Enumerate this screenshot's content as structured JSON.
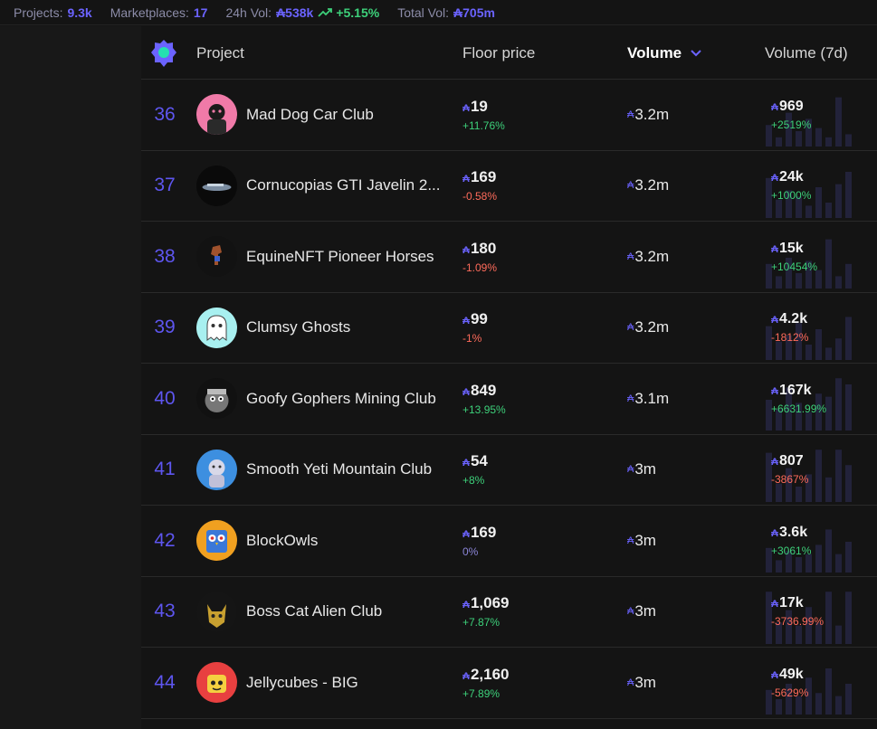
{
  "topbar": {
    "projects_label": "Projects:",
    "projects_value": "9.3k",
    "marketplaces_label": "Marketplaces:",
    "marketplaces_value": "17",
    "vol24_label": "24h Vol:",
    "vol24_value": "₳538k",
    "vol24_change": "+5.15%",
    "totalvol_label": "Total Vol:",
    "totalvol_value": "₳705m"
  },
  "header": {
    "project": "Project",
    "floor": "Floor price",
    "volume": "Volume",
    "volume7d": "Volume (7d)"
  },
  "colors": {
    "accent": "#6b63ff",
    "positive": "#3dd07a",
    "negative": "#ff6b5b",
    "bar": "#22223a"
  },
  "rows": [
    {
      "rank": "36",
      "name": "Mad Dog Car Club",
      "floor": "19",
      "floor_change": "+11.76%",
      "floor_dir": "pos",
      "volume": "3.2m",
      "vol7": "969",
      "vol7_change": "+2519%",
      "vol7_dir": "pos",
      "avatar_icon": "dog-avatar-icon",
      "avatar_bg": "#f07aa8",
      "bars": [
        0.35,
        0.15,
        0.55,
        0.25,
        0.45,
        0.3,
        0.15,
        0.8,
        0.2
      ]
    },
    {
      "rank": "37",
      "name": "Cornucopias GTI Javelin 2...",
      "floor": "169",
      "floor_change": "-0.58%",
      "floor_dir": "neg",
      "volume": "3.2m",
      "vol7": "24k",
      "vol7_change": "+1000%",
      "vol7_dir": "pos",
      "avatar_icon": "car-avatar-icon",
      "avatar_bg": "#0a0a0a",
      "bars": [
        0.65,
        0.3,
        0.45,
        0.35,
        0.2,
        0.5,
        0.25,
        0.55,
        0.75
      ]
    },
    {
      "rank": "38",
      "name": "EquineNFT Pioneer Horses",
      "floor": "180",
      "floor_change": "-1.09%",
      "floor_dir": "neg",
      "volume": "3.2m",
      "vol7": "15k",
      "vol7_change": "+10454%",
      "vol7_dir": "pos",
      "avatar_icon": "horse-avatar-icon",
      "avatar_bg": "#121212",
      "bars": [
        0.4,
        0.2,
        0.5,
        0.25,
        0.45,
        0.3,
        0.8,
        0.2,
        0.4
      ]
    },
    {
      "rank": "39",
      "name": "Clumsy Ghosts",
      "floor": "99",
      "floor_change": "-1%",
      "floor_dir": "neg",
      "volume": "3.2m",
      "vol7": "4.2k",
      "vol7_change": "-1812%",
      "vol7_dir": "neg",
      "avatar_icon": "ghost-avatar-icon",
      "avatar_bg": "#a8f0f0",
      "bars": [
        0.55,
        0.3,
        0.4,
        0.6,
        0.25,
        0.5,
        0.2,
        0.35,
        0.7
      ]
    },
    {
      "rank": "40",
      "name": "Goofy Gophers Mining Club",
      "floor": "849",
      "floor_change": "+13.95%",
      "floor_dir": "pos",
      "volume": "3.1m",
      "vol7": "167k",
      "vol7_change": "+6631.99%",
      "vol7_dir": "pos",
      "avatar_icon": "gopher-avatar-icon",
      "avatar_bg": "#111111",
      "bars": [
        0.5,
        0.35,
        0.7,
        0.45,
        0.3,
        0.6,
        0.55,
        0.85,
        0.75
      ]
    },
    {
      "rank": "41",
      "name": "Smooth Yeti Mountain Club",
      "floor": "54",
      "floor_change": "+8%",
      "floor_dir": "pos",
      "volume": "3m",
      "vol7": "807",
      "vol7_change": "-3867%",
      "vol7_dir": "neg",
      "avatar_icon": "yeti-avatar-icon",
      "avatar_bg": "#3d8fe0",
      "bars": [
        0.8,
        0.3,
        0.55,
        0.25,
        0.45,
        0.85,
        0.4,
        0.85,
        0.6
      ]
    },
    {
      "rank": "42",
      "name": "BlockOwls",
      "floor": "169",
      "floor_change": "0%",
      "floor_dir": "neu",
      "volume": "3m",
      "vol7": "3.6k",
      "vol7_change": "+3061%",
      "vol7_dir": "pos",
      "avatar_icon": "owl-avatar-icon",
      "avatar_bg": "#f0a020",
      "bars": [
        0.4,
        0.2,
        0.35,
        0.25,
        0.3,
        0.45,
        0.7,
        0.3,
        0.5
      ]
    },
    {
      "rank": "43",
      "name": "Boss Cat Alien Club",
      "floor": "1,069",
      "floor_change": "+7.87%",
      "floor_dir": "pos",
      "volume": "3m",
      "vol7": "17k",
      "vol7_change": "-3736.99%",
      "vol7_dir": "neg",
      "avatar_icon": "cat-alien-avatar-icon",
      "avatar_bg": "#151515",
      "bars": [
        0.85,
        0.35,
        0.55,
        0.3,
        0.6,
        0.35,
        0.85,
        0.3,
        0.85
      ]
    },
    {
      "rank": "44",
      "name": "Jellycubes - BIG",
      "floor": "2,160",
      "floor_change": "+7.89%",
      "floor_dir": "pos",
      "volume": "3m",
      "vol7": "49k",
      "vol7_change": "-5629%",
      "vol7_dir": "neg",
      "avatar_icon": "jellycube-avatar-icon",
      "avatar_bg": "#e84040",
      "bars": [
        0.4,
        0.25,
        0.5,
        0.3,
        0.6,
        0.35,
        0.75,
        0.3,
        0.5
      ]
    }
  ]
}
